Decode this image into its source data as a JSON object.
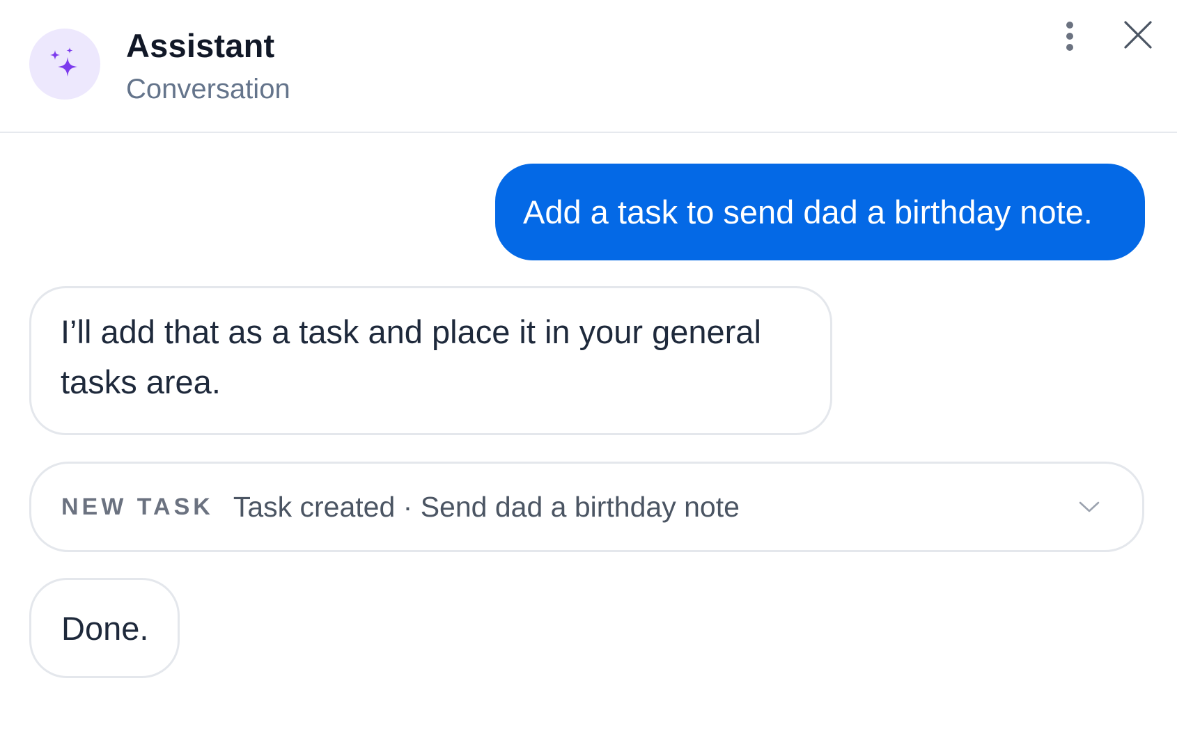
{
  "header": {
    "title": "Assistant",
    "subtitle": "Conversation",
    "avatar_icon": "sparkles-icon",
    "more_icon": "more-vertical-icon",
    "close_icon": "close-icon"
  },
  "messages": {
    "user_1": "Add a task to send dad a birthday note.",
    "assistant_1": "I’ll add that as a task and place it in your general tasks area.",
    "task_card": {
      "badge": "NEW TASK",
      "text": "Task created · Send dad a birthday note",
      "chevron_icon": "chevron-down-icon"
    },
    "assistant_2": "Done."
  },
  "colors": {
    "accent": "#0469e6",
    "avatar_bg": "#ede8fd",
    "sparkle": "#7c3aed",
    "border": "#e4e7ec"
  }
}
